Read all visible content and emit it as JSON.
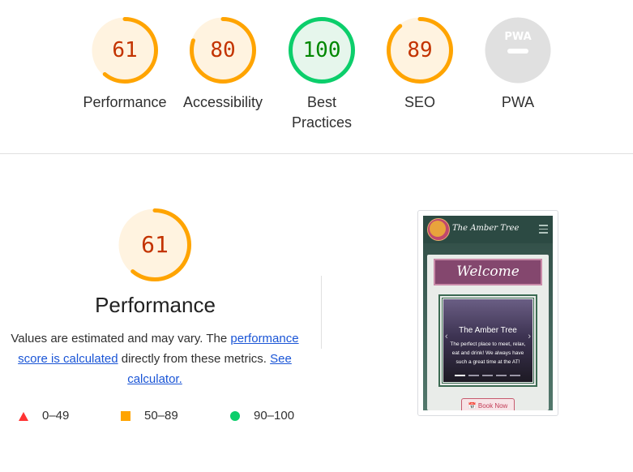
{
  "categories": [
    {
      "label": "Performance",
      "score": "61",
      "value": 61,
      "status_color": "#ffa400",
      "text_color": "#c33300",
      "fill_color": "#fff3e0"
    },
    {
      "label": "Accessibility",
      "score": "80",
      "value": 80,
      "status_color": "#ffa400",
      "text_color": "#c33300",
      "fill_color": "#fff3e0"
    },
    {
      "label": "Best Practices",
      "score": "100",
      "value": 100,
      "status_color": "#0cce6b",
      "text_color": "#008800",
      "fill_color": "#e6f6ec"
    },
    {
      "label": "SEO",
      "score": "89",
      "value": 89,
      "status_color": "#ffa400",
      "text_color": "#c33300",
      "fill_color": "#fff3e0"
    },
    {
      "label": "PWA",
      "badge": "PWA",
      "status_color": "#c2c2c2",
      "fill_color": "#e0e0e0"
    }
  ],
  "detail": {
    "score": "61",
    "value": 61,
    "title": "Performance",
    "desc_prefix": "Values are estimated and may vary. The ",
    "link1": "performance score is calculated",
    "desc_mid": " directly from these metrics. ",
    "link2": "See calculator."
  },
  "legend": [
    {
      "range": "0–49",
      "shape": "triangle",
      "color": "#ff3333"
    },
    {
      "range": "50–89",
      "shape": "square",
      "color": "#ffa400"
    },
    {
      "range": "90–100",
      "shape": "circle",
      "color": "#0cce6b"
    }
  ],
  "screenshot": {
    "brand": "The Amber Tree",
    "welcome": "Welcome",
    "carousel_title": "The Amber Tree",
    "carousel_text": "The perfect place to meet, relax, eat and drink! We always have such a great time at the AT!",
    "book_button": "📅 Book Now"
  }
}
